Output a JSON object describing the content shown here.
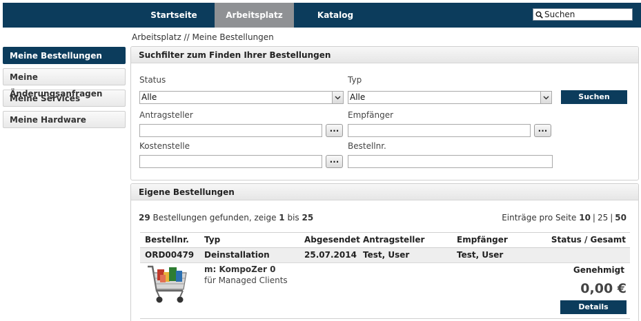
{
  "nav": {
    "tabs": [
      {
        "label": "Startseite",
        "active": false
      },
      {
        "label": "Arbeitsplatz",
        "active": true
      },
      {
        "label": "Katalog",
        "active": false
      }
    ],
    "search_placeholder": "Suchen"
  },
  "breadcrumb": "Arbeitsplatz // Meine Bestellungen",
  "sidebar": {
    "items": [
      {
        "label": "Meine Bestellungen",
        "active": true
      },
      {
        "label": "Meine Änderungsanfragen",
        "active": false
      },
      {
        "label": "Meine Services",
        "active": false
      },
      {
        "label": "Meine Hardware",
        "active": false
      }
    ]
  },
  "filter": {
    "title": "Suchfilter zum Finden Ihrer Bestellungen",
    "status_label": "Status",
    "status_value": "Alle",
    "typ_label": "Typ",
    "typ_value": "Alle",
    "antragsteller_label": "Antragsteller",
    "empfaenger_label": "Empfänger",
    "kostenstelle_label": "Kostenstelle",
    "bestellnr_label": "Bestellnr.",
    "picker_label": "...",
    "search_button": "Suchen"
  },
  "orders": {
    "title": "Eigene Bestellungen",
    "summary": {
      "count": "29",
      "text1": " Bestellungen gefunden, zeige ",
      "from": "1",
      "text2": " bis ",
      "to": "25"
    },
    "per_page": {
      "label": "Einträge pro Seite ",
      "options": [
        "10",
        "25",
        "50"
      ],
      "selected": [
        "10",
        "50"
      ],
      "sep": "|"
    },
    "columns": [
      "Bestellnr.",
      "Typ",
      "Abgesendet",
      "Antragsteller",
      "Empfänger",
      "Status / Gesamt"
    ],
    "rows": [
      {
        "nr": "ORD00479",
        "typ": "Deinstallation",
        "abgesendet": "25.07.2014",
        "antragsteller": "Test, User",
        "empfaenger": "Test, User",
        "item_title": "m: KompoZer 0",
        "item_sub": "für Managed Clients",
        "status": "Genehmigt",
        "total": "0,00 €",
        "details_label": "Details"
      }
    ]
  },
  "colors": {
    "nav_bg": "#0c3c5c",
    "nav_active": "#8f9194",
    "button_bg": "#0c3c5c"
  }
}
